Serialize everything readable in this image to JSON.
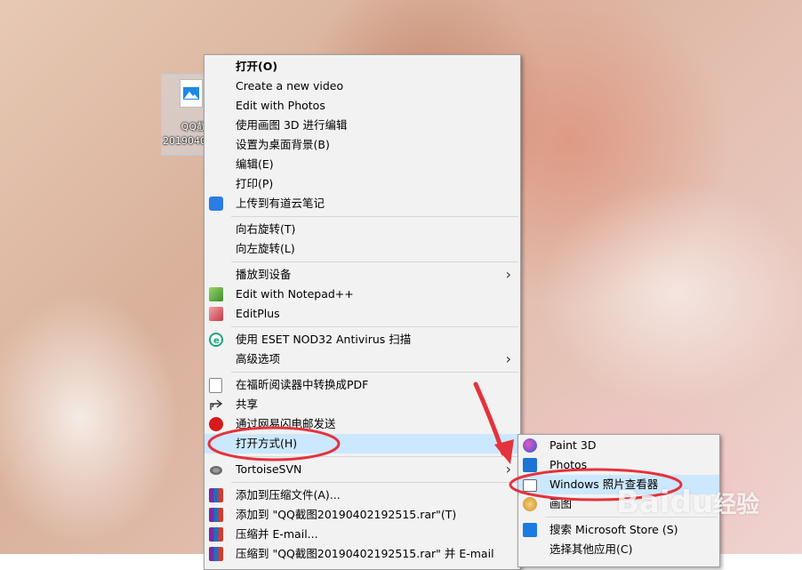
{
  "desktop_icon": {
    "label_line1": "QQ截",
    "label_line2": "2019040"
  },
  "context_menu": {
    "groups": [
      [
        {
          "label": "打开(O)",
          "icon": "",
          "bold": true
        },
        {
          "label": "Create a new video",
          "icon": ""
        },
        {
          "label": "Edit with Photos",
          "icon": ""
        },
        {
          "label": "使用画图 3D 进行编辑",
          "icon": ""
        },
        {
          "label": "设置为桌面背景(B)",
          "icon": ""
        },
        {
          "label": "编辑(E)",
          "icon": ""
        },
        {
          "label": "打印(P)",
          "icon": ""
        },
        {
          "label": "上传到有道云笔记",
          "icon": "youdao-note-icon"
        }
      ],
      [
        {
          "label": "向右旋转(T)",
          "icon": ""
        },
        {
          "label": "向左旋转(L)",
          "icon": ""
        }
      ],
      [
        {
          "label": "播放到设备",
          "icon": "",
          "submenu": true
        },
        {
          "label": "Edit with Notepad++",
          "icon": "notepad-plus-icon"
        },
        {
          "label": "EditPlus",
          "icon": "editplus-icon"
        }
      ],
      [
        {
          "label": "使用 ESET NOD32 Antivirus 扫描",
          "icon": "eset-icon"
        },
        {
          "label": "高级选项",
          "icon": "",
          "submenu": true
        }
      ],
      [
        {
          "label": "在福昕阅读器中转换成PDF",
          "icon": "foxit-pdf-icon"
        },
        {
          "label": "共享",
          "icon": "share-icon"
        },
        {
          "label": "通过网易闪电邮发送",
          "icon": "netease-mail-icon"
        },
        {
          "label": "打开方式(H)",
          "icon": "",
          "submenu": true,
          "highlighted": true
        }
      ],
      [
        {
          "label": "TortoiseSVN",
          "icon": "tortoisesvn-icon",
          "submenu": true
        }
      ],
      [
        {
          "label": "添加到压缩文件(A)...",
          "icon": "winrar-icon"
        },
        {
          "label": "添加到 \"QQ截图20190402192515.rar\"(T)",
          "icon": "winrar-icon"
        },
        {
          "label": "压缩并 E-mail...",
          "icon": "winrar-icon"
        },
        {
          "label": "压缩到 \"QQ截图20190402192515.rar\" 并 E-mail",
          "icon": "winrar-icon"
        }
      ]
    ]
  },
  "open_with_submenu": {
    "items": [
      {
        "label": "Paint 3D",
        "icon": "paint3d-icon"
      },
      {
        "label": "Photos",
        "icon": "photos-icon"
      },
      {
        "label": "Windows 照片查看器",
        "icon": "photo-viewer-icon",
        "highlighted": true
      },
      {
        "label": "画图",
        "icon": "mspaint-icon"
      }
    ],
    "footer": [
      {
        "label": "搜索 Microsoft Store (S)",
        "icon": "store-icon"
      },
      {
        "label": "选择其他应用(C)",
        "icon": ""
      }
    ]
  },
  "watermark": {
    "text": "Baidu",
    "suffix": "经验"
  },
  "colors": {
    "highlight": "#cce8ff",
    "annotation": "#e5323c",
    "menu_bg": "#f2f2f2"
  }
}
